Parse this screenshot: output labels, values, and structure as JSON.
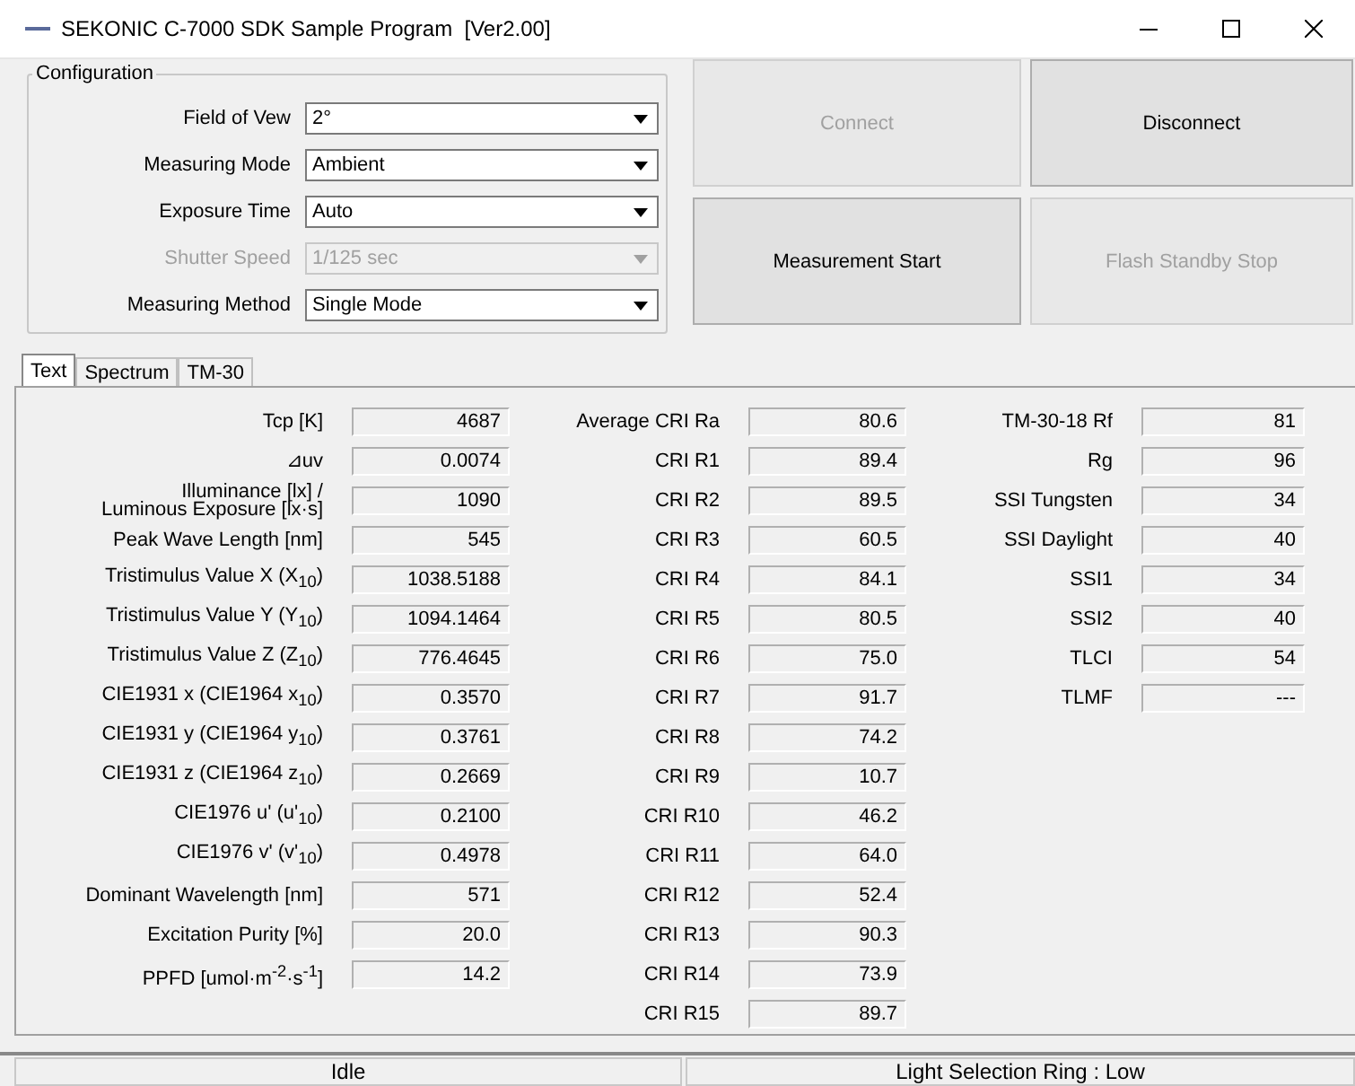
{
  "window": {
    "title": "SEKONIC C-7000 SDK Sample Program  [Ver2.00]"
  },
  "configuration": {
    "title": "Configuration",
    "fields": [
      {
        "label": "Field of Vew",
        "value": "2°",
        "disabled": false
      },
      {
        "label": "Measuring Mode",
        "value": "Ambient",
        "disabled": false
      },
      {
        "label": "Exposure Time",
        "value": "Auto",
        "disabled": false
      },
      {
        "label": "Shutter Speed",
        "value": "1/125 sec",
        "disabled": true
      },
      {
        "label": "Measuring Method",
        "value": "Single Mode",
        "disabled": false
      }
    ]
  },
  "buttons": [
    {
      "label": "Connect",
      "disabled": true
    },
    {
      "label": "Disconnect",
      "disabled": false
    },
    {
      "label": "Measurement Start",
      "disabled": false
    },
    {
      "label": "Flash Standby Stop",
      "disabled": true
    }
  ],
  "tabs": [
    {
      "label": "Text",
      "selected": true
    },
    {
      "label": "Spectrum",
      "selected": false
    },
    {
      "label": "TM-30",
      "selected": false
    }
  ],
  "columns": [
    [
      {
        "label": "Tcp [K]",
        "value": "4687"
      },
      {
        "label": "⊿uv",
        "value": "0.0074"
      },
      {
        "label": "Illuminance [lx] /\nLuminous Exposure [lx·s]",
        "value": "1090"
      },
      {
        "label": "Peak Wave Length [nm]",
        "value": "545"
      },
      {
        "label": "Tristimulus Value X (X$_{10}$)",
        "value": "1038.5188"
      },
      {
        "label": "Tristimulus Value Y (Y$_{10}$)",
        "value": "1094.1464"
      },
      {
        "label": "Tristimulus Value Z (Z$_{10}$)",
        "value": "776.4645"
      },
      {
        "label": "CIE1931 x (CIE1964 x$_{10}$)",
        "value": "0.3570"
      },
      {
        "label": "CIE1931 y (CIE1964 y$_{10}$)",
        "value": "0.3761"
      },
      {
        "label": "CIE1931 z (CIE1964 z$_{10}$)",
        "value": "0.2669"
      },
      {
        "label": "CIE1976 u' (u'$_{10}$)",
        "value": "0.2100"
      },
      {
        "label": "CIE1976 v' (v'$_{10}$)",
        "value": "0.4978"
      },
      {
        "label": "Dominant Wavelength [nm]",
        "value": "571"
      },
      {
        "label": "Excitation Purity [%]",
        "value": "20.0"
      },
      {
        "label": "PPFD [umol·m$^{-2}$·s$^{-1}$]",
        "value": "14.2"
      }
    ],
    [
      {
        "label": "Average CRI Ra",
        "value": "80.6"
      },
      {
        "label": "CRI R1",
        "value": "89.4"
      },
      {
        "label": "CRI R2",
        "value": "89.5"
      },
      {
        "label": "CRI R3",
        "value": "60.5"
      },
      {
        "label": "CRI R4",
        "value": "84.1"
      },
      {
        "label": "CRI R5",
        "value": "80.5"
      },
      {
        "label": "CRI R6",
        "value": "75.0"
      },
      {
        "label": "CRI R7",
        "value": "91.7"
      },
      {
        "label": "CRI R8",
        "value": "74.2"
      },
      {
        "label": "CRI R9",
        "value": "10.7"
      },
      {
        "label": "CRI R10",
        "value": "46.2"
      },
      {
        "label": "CRI R11",
        "value": "64.0"
      },
      {
        "label": "CRI R12",
        "value": "52.4"
      },
      {
        "label": "CRI R13",
        "value": "90.3"
      },
      {
        "label": "CRI R14",
        "value": "73.9"
      },
      {
        "label": "CRI R15",
        "value": "89.7"
      }
    ],
    [
      {
        "label": "TM-30-18 Rf",
        "value": "81"
      },
      {
        "label": "Rg",
        "value": "96"
      },
      {
        "label": "SSI Tungsten",
        "value": "34"
      },
      {
        "label": "SSI Daylight",
        "value": "40"
      },
      {
        "label": "SSI1",
        "value": "34"
      },
      {
        "label": "SSI2",
        "value": "40"
      },
      {
        "label": "TLCI",
        "value": "54"
      },
      {
        "label": "TLMF",
        "value": "---"
      }
    ]
  ],
  "status_bar": [
    "Idle",
    "Light Selection Ring : Low"
  ]
}
